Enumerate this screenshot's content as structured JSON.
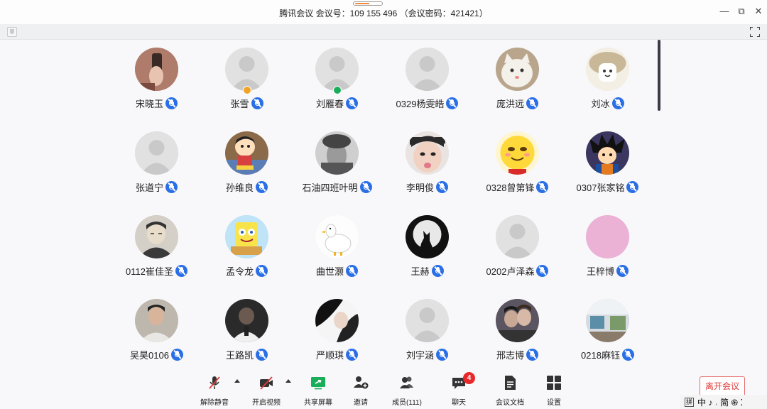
{
  "window": {
    "title": "腾讯会议 会议号：109 155 496 （会议密码：421421）",
    "minimize_glyph": "—",
    "restore_glyph": "⧉",
    "close_glyph": "✕"
  },
  "participants": [
    {
      "name": "宋晓玉",
      "avatar": "photo-hand"
    },
    {
      "name": "张雪",
      "avatar": "default",
      "badge": "orange"
    },
    {
      "name": "刘雁春",
      "avatar": "default",
      "badge": "green"
    },
    {
      "name": "0329杨雯皓",
      "avatar": "default"
    },
    {
      "name": "庞洪远",
      "avatar": "cat"
    },
    {
      "name": "刘冰",
      "avatar": "cartoon-mushroom"
    },
    {
      "name": "张道宁",
      "avatar": "default"
    },
    {
      "name": "孙维良",
      "avatar": "cartoon-boy"
    },
    {
      "name": "石油四班叶明",
      "avatar": "photo-bw"
    },
    {
      "name": "李明俊",
      "avatar": "photo-face"
    },
    {
      "name": "0328曾第锋",
      "avatar": "smiley"
    },
    {
      "name": "0307张家铭",
      "avatar": "cartoon-goku"
    },
    {
      "name": "0112崔佳圣",
      "avatar": "sketch-man"
    },
    {
      "name": "孟令龙",
      "avatar": "sponge"
    },
    {
      "name": "曲世灏",
      "avatar": "duck"
    },
    {
      "name": "王赫",
      "avatar": "wolf-moon"
    },
    {
      "name": "0202卢泽森",
      "avatar": "default"
    },
    {
      "name": "王梓博",
      "avatar": "pink"
    },
    {
      "name": "吴昊0106",
      "avatar": "photo-man"
    },
    {
      "name": "王路凯",
      "avatar": "photo-dark"
    },
    {
      "name": "严顺琪",
      "avatar": "photo-lady"
    },
    {
      "name": "刘宇涵",
      "avatar": "default"
    },
    {
      "name": "邢志博",
      "avatar": "photo-couple"
    },
    {
      "name": "0218麻钰",
      "avatar": "photo-room"
    }
  ],
  "toolbar": {
    "unmute": "解除静音",
    "video": "开启视频",
    "share": "共享屏幕",
    "invite": "邀请",
    "members": "成员(111)",
    "chat": "聊天",
    "chat_badge": "4",
    "docs": "会议文档",
    "settings": "设置",
    "leave": "离开会议"
  },
  "ime": {
    "box": "拼",
    "text": "中 ♪ ˒ 简 ֍ ⁚"
  },
  "colors": {
    "mic_blue": "#2b6fe6",
    "leave_red": "#e03a3a",
    "share_green": "#1aad5a",
    "badge_red": "#e8282b"
  }
}
